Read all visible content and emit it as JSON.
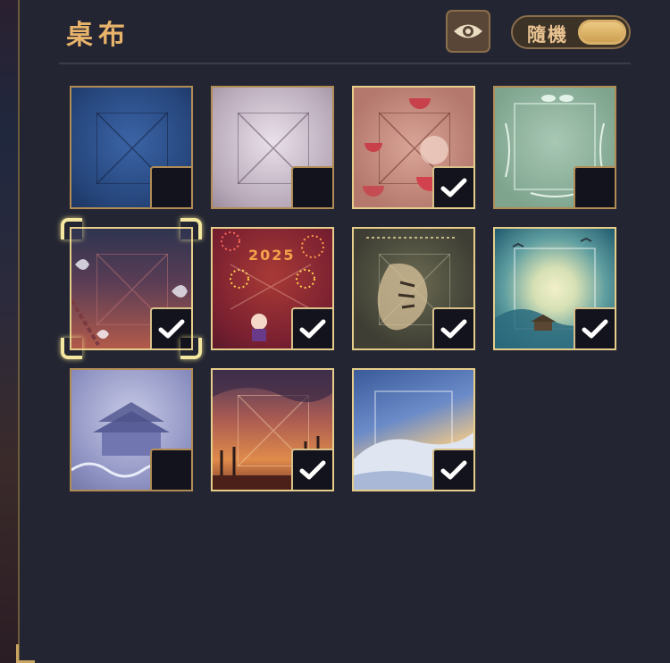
{
  "header": {
    "title": "桌布"
  },
  "controls": {
    "preview_icon": "eye-icon",
    "random_label": "隨機",
    "random_on": true
  },
  "tiles": [
    {
      "theme": "blue-cloth",
      "owned": false,
      "selected": false
    },
    {
      "theme": "lilac-cloth",
      "owned": false,
      "selected": false
    },
    {
      "theme": "watermelon",
      "owned": true,
      "selected": false
    },
    {
      "theme": "green-leaves",
      "owned": false,
      "selected": false
    },
    {
      "theme": "butterfly-chains",
      "owned": true,
      "selected": true
    },
    {
      "theme": "fireworks-2025",
      "owned": true,
      "selected": false
    },
    {
      "theme": "tiger",
      "owned": true,
      "selected": false
    },
    {
      "theme": "moon-pavilion",
      "owned": true,
      "selected": false
    },
    {
      "theme": "blue-palace",
      "owned": false,
      "selected": false
    },
    {
      "theme": "sunset-field",
      "owned": true,
      "selected": false
    },
    {
      "theme": "snowy-sky",
      "owned": true,
      "selected": false
    }
  ],
  "fireworks_text": "2025",
  "colors": {
    "accent_gold": "#e8b36a",
    "panel": "#232532",
    "check": "#ffffff"
  }
}
